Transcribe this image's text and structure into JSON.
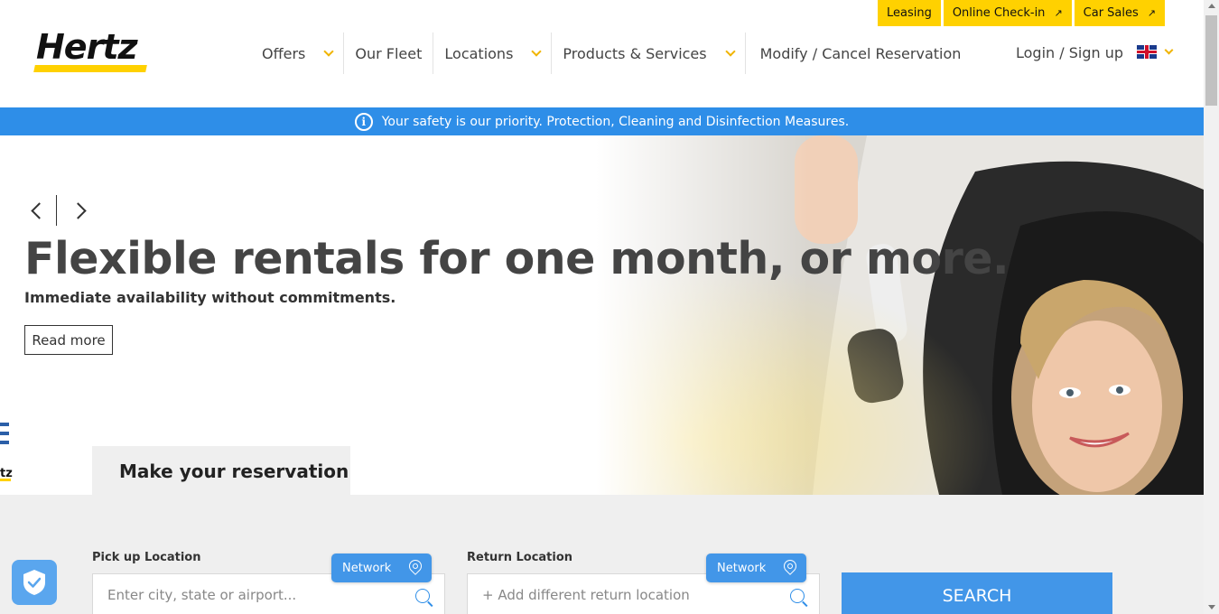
{
  "brand": {
    "logo_text": "Hertz",
    "accent": "#ffd100",
    "blue": "#2e8ee8"
  },
  "top_links": [
    {
      "label": "Leasing",
      "external": false
    },
    {
      "label": "Online Check-in",
      "external": true
    },
    {
      "label": "Car Sales",
      "external": true
    }
  ],
  "nav": {
    "items": [
      {
        "label": "Offers",
        "dropdown": true
      },
      {
        "label": "Our Fleet",
        "dropdown": false
      },
      {
        "label": "Locations",
        "dropdown": true
      },
      {
        "label": "Products & Services",
        "dropdown": true
      },
      {
        "label": "Modify / Cancel Reservation",
        "dropdown": false
      }
    ],
    "login": "Login / Sign up",
    "language_icon": "uk-flag-icon"
  },
  "banner": {
    "text": "Your safety is our priority. Protection, Cleaning and Disinfection Measures."
  },
  "hero": {
    "headline": "Flexible rentals for one month, or more.",
    "subhead": "Immediate availability without commitments.",
    "read_more": "Read more"
  },
  "reservation": {
    "tab_label": "Make your reservation",
    "pickup": {
      "label": "Pick up Location",
      "placeholder": "Enter city, state or airport...",
      "network": "Network"
    },
    "return": {
      "label": "Return Location",
      "placeholder": "+ Add different return location",
      "network": "Network"
    },
    "search": "SEARCH"
  }
}
